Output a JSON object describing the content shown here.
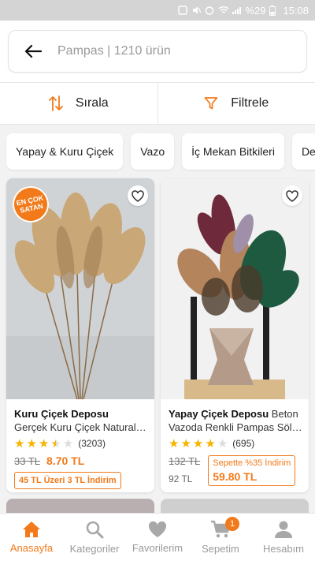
{
  "status_bar": {
    "battery_percent": "%29",
    "time": "15:08"
  },
  "search": {
    "query": "Pampas",
    "result_count": "1210 ürün",
    "display": "Pampas | 1210 ürün"
  },
  "sort_filter": {
    "sort_label": "Sırala",
    "filter_label": "Filtrele"
  },
  "category_chips": [
    "Yapay & Kuru Çiçek",
    "Vazo",
    "İç Mekan Bitkileri",
    "De"
  ],
  "products": [
    {
      "badge_line1": "EN ÇOK",
      "badge_line2": "SATAN",
      "brand": "Kuru Çiçek Deposu",
      "name": "Gerçek Kuru Çiçek Natural…",
      "rating": 3.5,
      "rating_count": "(3203)",
      "old_price": "33 TL",
      "price": "8.70 TL",
      "promo": "45 TL Üzeri 3 TL İndirim"
    },
    {
      "brand": "Yapay Çiçek Deposu",
      "name": "Beton Vazoda Renkli Pampas Söl…",
      "rating": 4,
      "rating_count": "(695)",
      "old_price": "132 TL",
      "regular_price": "92 TL",
      "cart_discount_label": "Sepette %35 İndirim",
      "cart_price": "59.80 TL"
    }
  ],
  "bottom_nav": [
    {
      "label": "Anasayfa",
      "icon": "home-icon",
      "active": true
    },
    {
      "label": "Kategoriler",
      "icon": "search-icon"
    },
    {
      "label": "Favorilerim",
      "icon": "heart-icon"
    },
    {
      "label": "Sepetim",
      "icon": "cart-icon",
      "badge": "1"
    },
    {
      "label": "Hesabım",
      "icon": "user-icon"
    }
  ],
  "colors": {
    "accent": "#f27a1a",
    "star": "#f5b400",
    "status_bar": "#d4d4d4"
  }
}
